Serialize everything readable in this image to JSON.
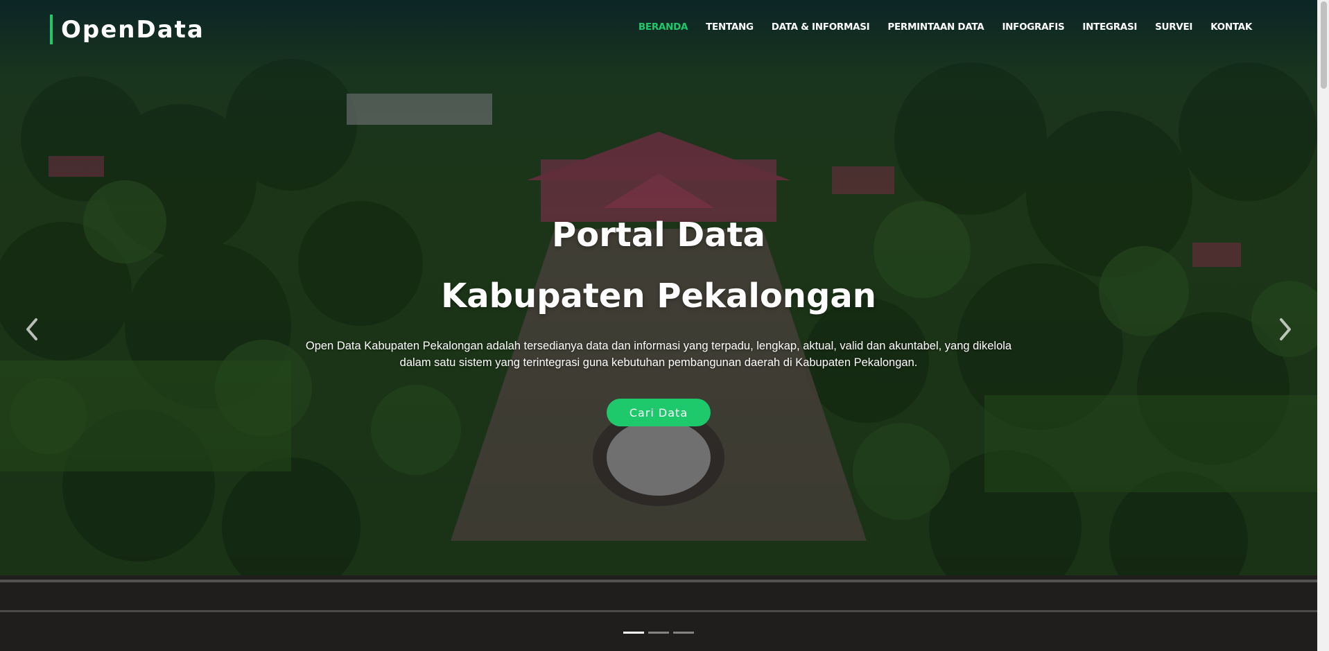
{
  "brand": {
    "logo_text": "OpenData",
    "accent_color": "#1ec96c"
  },
  "nav": {
    "items": [
      {
        "label": "BERANDA",
        "active": true
      },
      {
        "label": "TENTANG",
        "active": false
      },
      {
        "label": "DATA & INFORMASI",
        "active": false
      },
      {
        "label": "PERMINTAAN DATA",
        "active": false
      },
      {
        "label": "INFOGRAFIS",
        "active": false
      },
      {
        "label": "INTEGRASI",
        "active": false
      },
      {
        "label": "SURVEI",
        "active": false
      },
      {
        "label": "KONTAK",
        "active": false
      }
    ]
  },
  "hero": {
    "title_line1": "Portal Data",
    "title_line2": "Kabupaten Pekalongan",
    "description": "Open Data Kabupaten Pekalongan adalah tersedianya data dan informasi yang terpadu, lengkap, aktual, valid dan akuntabel, yang dikelola dalam satu sistem yang terintegrasi guna kebutuhan pembangunan daerah di Kabupaten Pekalongan.",
    "cta_label": "Cari Data"
  },
  "carousel": {
    "prev_icon": "chevron-left-icon",
    "next_icon": "chevron-right-icon",
    "slide_count": 3,
    "active_slide": 1
  }
}
